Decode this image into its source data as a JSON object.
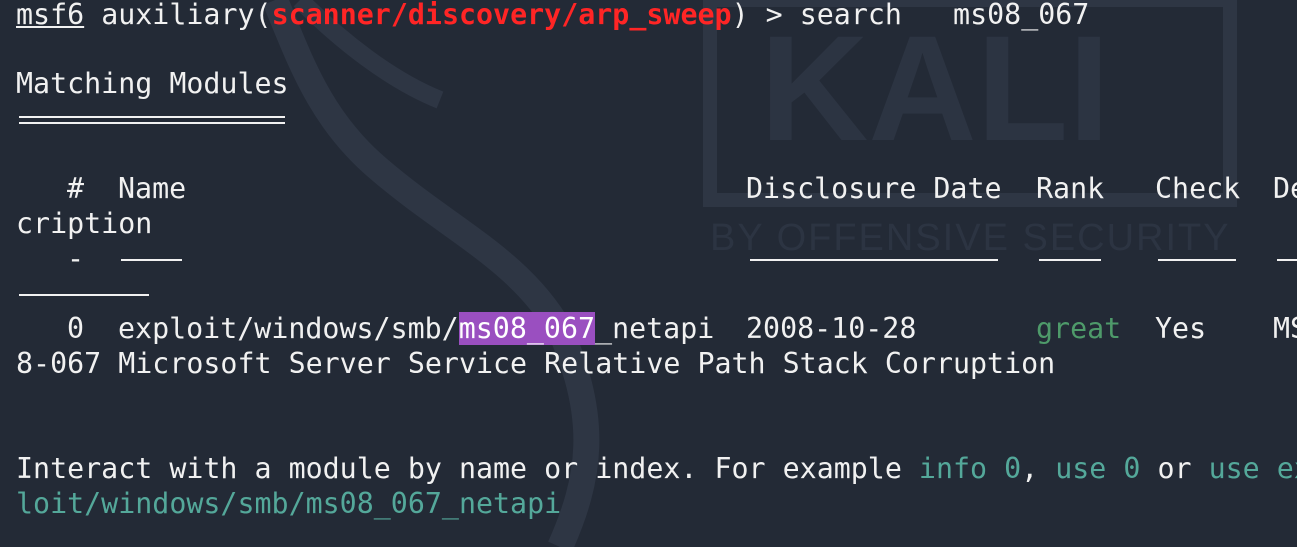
{
  "watermark": {
    "logo_text": "KALI",
    "tagline": "BY OFFENSIVE SECURITY"
  },
  "prompt": {
    "name": "msf6",
    "context_prefix": "auxiliary(",
    "module": "scanner/discovery/arp_sweep",
    "context_suffix": ") > ",
    "command": "search   ms08_067"
  },
  "section": {
    "heading": "Matching Modules"
  },
  "table": {
    "columns": {
      "index": "#",
      "name": "Name",
      "date": "Disclosure Date",
      "rank": "Rank",
      "check": "Check",
      "desc_start": "De",
      "desc_wrap": "cription"
    },
    "index_rule": "-",
    "rows": [
      {
        "index": "0",
        "name_pre": "exploit/windows/smb/",
        "name_match": "ms08_067",
        "name_post": "_netapi",
        "date": "2008-10-28",
        "rank": "great",
        "check": "Yes",
        "desc_start": "MS",
        "desc_wrap": "8-067 Microsoft Server Service Relative Path Stack Corruption"
      }
    ]
  },
  "hint": {
    "text": "Interact with a module by name or index. For example ",
    "cmd1": "info 0",
    "sep1": ", ",
    "cmd2": "use 0",
    "sep2": " or ",
    "cmd3_start": "use ex",
    "cmd3_wrap": "loit/windows/smb/ms08_067_netapi"
  },
  "colors": {
    "background": "#232a36",
    "foreground": "#f1f1f1",
    "module_red": "#ff2525",
    "rank_green": "#4e9a6a",
    "highlight_purple": "#9a4fc0",
    "hint_teal": "#54a89a"
  }
}
